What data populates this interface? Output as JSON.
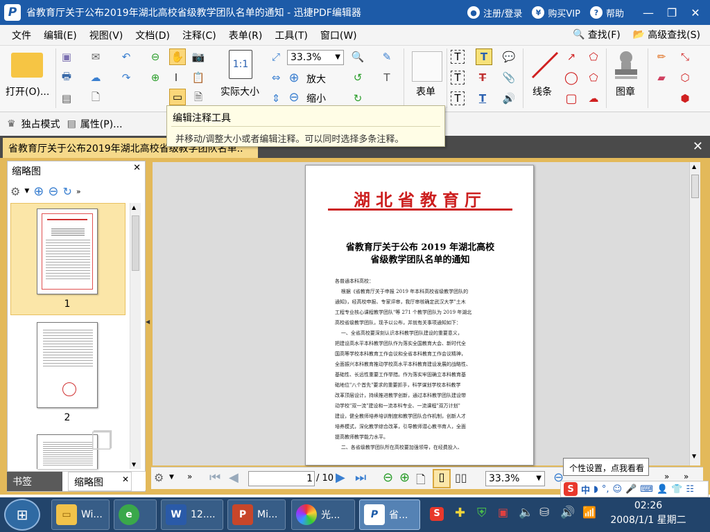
{
  "window": {
    "title": "省教育厅关于公布2019年湖北高校省级教学团队名单的通知 - 迅捷PDF编辑器",
    "login": "注册/登录",
    "vip": "购买VIP",
    "help": "帮助"
  },
  "menubar": {
    "items": [
      "文件",
      "编辑(E)",
      "视图(V)",
      "文档(D)",
      "注释(C)",
      "表单(R)",
      "工具(T)",
      "窗口(W)"
    ],
    "find": "查找(F)",
    "advanced_find": "高级查找(S)"
  },
  "ribbon": {
    "open": "打开(O)...",
    "zoom_value": "33.3%",
    "zoom_in": "放大",
    "zoom_out": "缩小",
    "actual_size": "实际大小",
    "actual_size_icon": "1:1",
    "form": "表单",
    "line": "线条",
    "stamp": "图章"
  },
  "subbar": {
    "exclusive_mode": "独占模式",
    "properties": "属性(P)..."
  },
  "tooltip": {
    "title": "编辑注释工具",
    "description": "并移动/调整大小或者编辑注释。可以同时选择多条注释。"
  },
  "doc_tab": {
    "label": "省教育厅关于公布2019年湖北高校省级教学团队名单.."
  },
  "side_panel": {
    "title": "缩略图",
    "thumbnails": [
      "1",
      "2"
    ],
    "bottom_tabs": [
      "书签",
      "缩略图"
    ]
  },
  "page": {
    "header": "湖北省教育厅",
    "title_line1": "省教育厅关于公布 2019 年湖北高校",
    "title_line2": "省级教学团队名单的通知",
    "body": "各普通本科高校：\n    根据《省教育厅关于申报 2019 年本科高校省级教学团队的\n通知》，经高校申报、专家评审，我厅审核确定武汉大学\"土木\n工程专业核心课程教学团队\"等 271 个教学团队为 2019 年湖北\n高校省级教学团队，现予以公布，并就有关事项通知如下：\n    一、全省高校要深刻认识本科教学团队建设的重要意义，\n把建设高水平本科教学团队作为落实全国教育大会、新时代全\n国高等学校本科教育工作会议和全省本科教育工作会议精神，\n全面振兴本科教育推动学校高水平本科教育建设发展的战略性、\n基础性、长远性重要工作举措。作为落实牢固确立本科教育基\n础地位\"八个首先\"要求的重要抓手，科学谋划学校本科教学\n改革顶层设计，持续推进教学创新，通过本科教学团队建设带\n动学校\"双一流\"建设和一流本科专业、一流课程\"双万计划\"\n建设，健全教师培养培训制度和教学团队合作机制，创新人才\n培养模式，深化教学综合改革，引导教师潜心教书育人，全面\n提高教师教学能力水平。\n    二、各省级教学团队所在高校要加强领导，在经费投入、"
  },
  "navbar": {
    "current_page": "1",
    "total_pages": "/ 10",
    "zoom_value": "33.3%"
  },
  "tip2": "个性设置，点我看看",
  "ime": {
    "mode": "中"
  },
  "taskbar": {
    "tasks": [
      "Wi...",
      "",
      "12....",
      "Mi...",
      "光...",
      "省..."
    ],
    "time": "02:26",
    "date": "2008/1/1 星期二"
  }
}
